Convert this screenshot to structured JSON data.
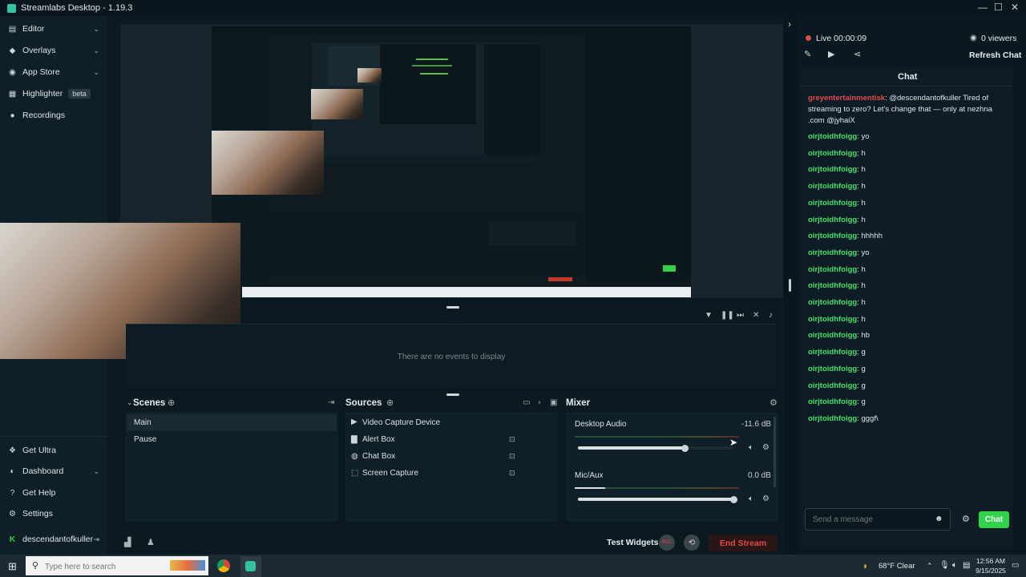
{
  "app": {
    "title": "Streamlabs Desktop - 1.19.3"
  },
  "window_controls": {
    "minimize": "—",
    "maximize": "☐",
    "close": "✕"
  },
  "sidebar": {
    "items": [
      {
        "label": "Editor",
        "icon": "editor-icon"
      },
      {
        "label": "Overlays",
        "icon": "overlays-icon"
      },
      {
        "label": "App Store",
        "icon": "app-store-icon"
      },
      {
        "label": "Highlighter",
        "icon": "highlighter-icon",
        "badge": "beta"
      },
      {
        "label": "Recordings",
        "icon": "recordings-icon"
      }
    ],
    "bottom_items": [
      {
        "label": "Get Ultra",
        "icon": "ultra-icon"
      },
      {
        "label": "Dashboard",
        "icon": "dashboard-icon"
      },
      {
        "label": "Get Help",
        "icon": "help-icon"
      },
      {
        "label": "Settings",
        "icon": "settings-icon"
      }
    ],
    "account": "descendantofkuller"
  },
  "events": {
    "empty_text": "There are no events to display"
  },
  "scenes": {
    "title": "Scenes",
    "items": [
      "Main",
      "Pause"
    ]
  },
  "sources": {
    "title": "Sources",
    "items": [
      "Video Capture Device",
      "Alert Box",
      "Chat Box",
      "Screen Capture"
    ]
  },
  "mixer": {
    "title": "Mixer",
    "channels": [
      {
        "name": "Desktop Audio",
        "db": "-11.6 dB",
        "volume": 0.69
      },
      {
        "name": "Mic/Aux",
        "db": "0.0 dB",
        "volume": 1.0
      }
    ]
  },
  "footer": {
    "test_widgets": "Test Widgets",
    "rec": "REC",
    "end_stream": "End Stream"
  },
  "live": {
    "status": "Live 00:00:09",
    "viewers": "0 viewers",
    "refresh": "Refresh Chat"
  },
  "chat": {
    "title": "Chat",
    "messages": [
      {
        "user": "greyentertainmentisk",
        "text": "@descendantofkuller Tired of streaming to zero? Let's change that — only at nezhna .com @jyhaiX",
        "spam": true
      },
      {
        "user": "oirjtoidhfoigg",
        "text": "yo"
      },
      {
        "user": "oirjtoidhfoigg",
        "text": "h"
      },
      {
        "user": "oirjtoidhfoigg",
        "text": "h"
      },
      {
        "user": "oirjtoidhfoigg",
        "text": "h"
      },
      {
        "user": "oirjtoidhfoigg",
        "text": "h"
      },
      {
        "user": "oirjtoidhfoigg",
        "text": "h"
      },
      {
        "user": "oirjtoidhfoigg",
        "text": "hhhhh"
      },
      {
        "user": "oirjtoidhfoigg",
        "text": "yo"
      },
      {
        "user": "oirjtoidhfoigg",
        "text": "h"
      },
      {
        "user": "oirjtoidhfoigg",
        "text": "h"
      },
      {
        "user": "oirjtoidhfoigg",
        "text": "h"
      },
      {
        "user": "oirjtoidhfoigg",
        "text": "h"
      },
      {
        "user": "oirjtoidhfoigg",
        "text": "hb"
      },
      {
        "user": "oirjtoidhfoigg",
        "text": "g"
      },
      {
        "user": "oirjtoidhfoigg",
        "text": "g"
      },
      {
        "user": "oirjtoidhfoigg",
        "text": "g"
      },
      {
        "user": "oirjtoidhfoigg",
        "text": "g"
      },
      {
        "user": "oirjtoidhfoigg",
        "text": "gggf\\"
      }
    ],
    "input_placeholder": "Send a message",
    "send_label": "Chat"
  },
  "taskbar": {
    "search_placeholder": "Type here to search",
    "weather": "68°F  Clear",
    "time": "12:56 AM",
    "date": "9/15/2025"
  },
  "colors": {
    "accent": "#31c3a2",
    "chat_green": "#47e06a",
    "end_stream": "#e14b4b",
    "send_button": "#31d34a"
  }
}
